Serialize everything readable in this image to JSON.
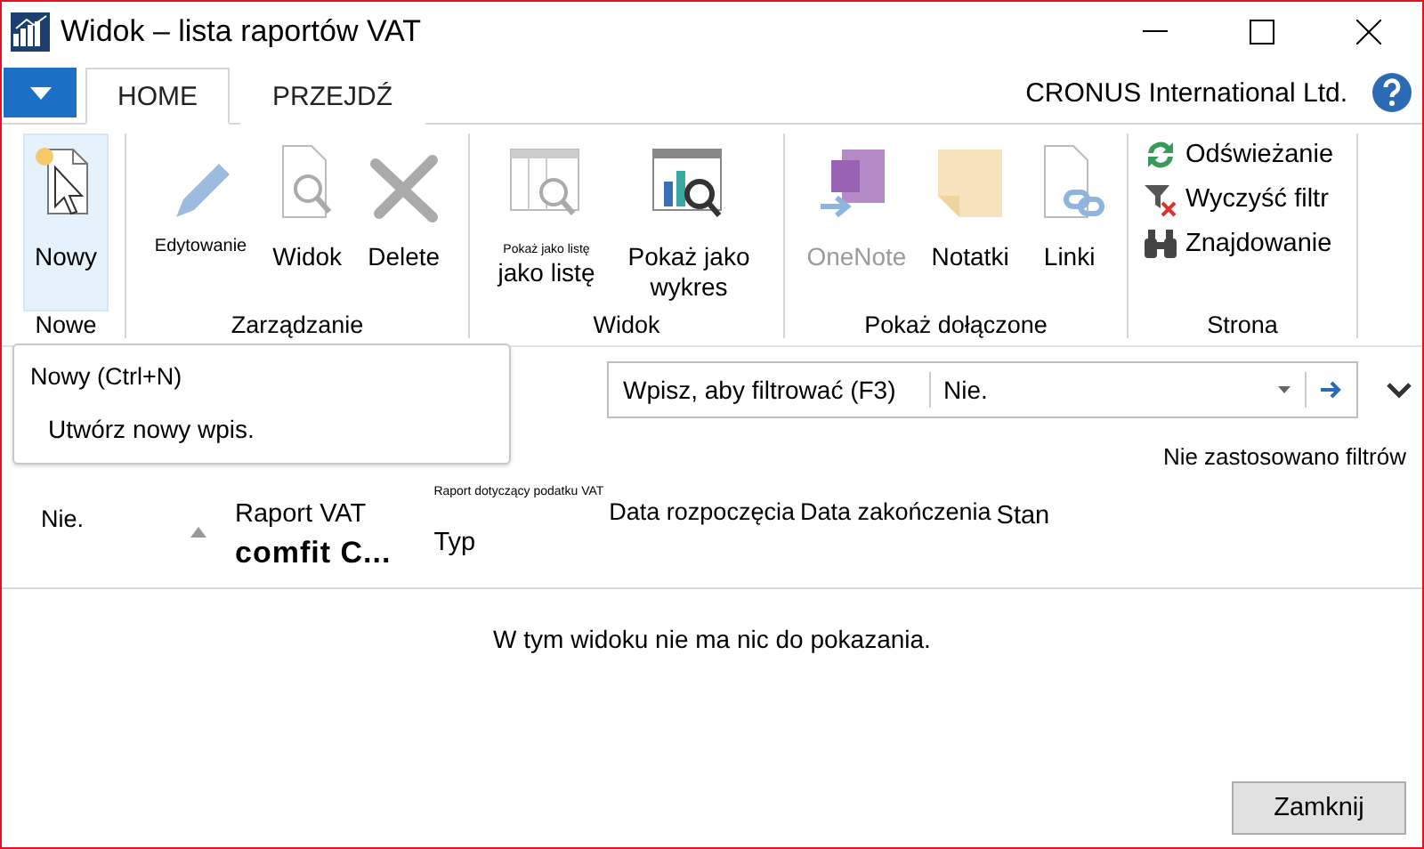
{
  "window": {
    "title": "Widok – lista raportów VAT"
  },
  "tabs": [
    {
      "label": "HOME",
      "selected": true
    },
    {
      "label": "PRZEJDŹ",
      "selected": false
    }
  ],
  "company": "CRONUS International Ltd.",
  "ribbon": [
    {
      "title": "Nowe",
      "buttons": [
        {
          "kind": "large",
          "label": "Nowy",
          "selected": true,
          "disabled": false
        }
      ]
    },
    {
      "title": "Zarządzanie",
      "buttons": [
        {
          "kind": "tiny",
          "label": "Edytowanie",
          "selected": false,
          "disabled": false
        },
        {
          "kind": "large",
          "label": "Widok",
          "selected": false,
          "disabled": false
        },
        {
          "kind": "large",
          "label": "Delete",
          "selected": false,
          "disabled": false
        }
      ]
    },
    {
      "title": "Widok",
      "buttons": [
        {
          "kind": "captioned",
          "caption": "Pokaż jako listę",
          "label": "jako listę",
          "selected": false,
          "disabled": false
        },
        {
          "kind": "large",
          "label": "Pokaż jako wykres",
          "selected": false,
          "disabled": false
        }
      ]
    },
    {
      "title": "Pokaż dołączone",
      "buttons": [
        {
          "kind": "large",
          "label": "OneNote",
          "selected": false,
          "disabled": true
        },
        {
          "kind": "large",
          "label": "Notatki",
          "selected": false,
          "disabled": false
        },
        {
          "kind": "large",
          "label": "Linki",
          "selected": false,
          "disabled": false
        }
      ]
    },
    {
      "title": "Strona",
      "buttons": [
        {
          "kind": "row",
          "label": "Odświeżanie",
          "selected": false,
          "disabled": false
        },
        {
          "kind": "row",
          "label": "Wyczyść filtr",
          "selected": false,
          "disabled": false
        },
        {
          "kind": "row",
          "label": "Znajdowanie",
          "selected": false,
          "disabled": false
        }
      ]
    }
  ],
  "tooltip": {
    "title": "Nowy (Ctrl+N)",
    "description": "Utwórz nowy wpis."
  },
  "filter": {
    "placeholder": "Wpisz, aby filtrować (F3)",
    "field": "Nie."
  },
  "filter_status": "Nie zastosowano filtrów",
  "columns": [
    {
      "kind": "plain",
      "label": "Nie.",
      "sorted": true
    },
    {
      "kind": "two-line",
      "label": "Raport VAT",
      "sub": "comfit C...",
      "sorted": false
    },
    {
      "kind": "captioned",
      "caption": "Raport dotyczący podatku VAT",
      "label": "Typ",
      "sorted": false
    },
    {
      "kind": "plain",
      "label": "Data rozpoczęcia",
      "sorted": false
    },
    {
      "kind": "plain",
      "label": "Data zakończenia",
      "sorted": false
    },
    {
      "kind": "plain",
      "label": "Stan",
      "sorted": false
    }
  ],
  "empty_message": "W tym widoku nie ma nic do pokazania.",
  "buttons": [
    "Zamknij"
  ]
}
